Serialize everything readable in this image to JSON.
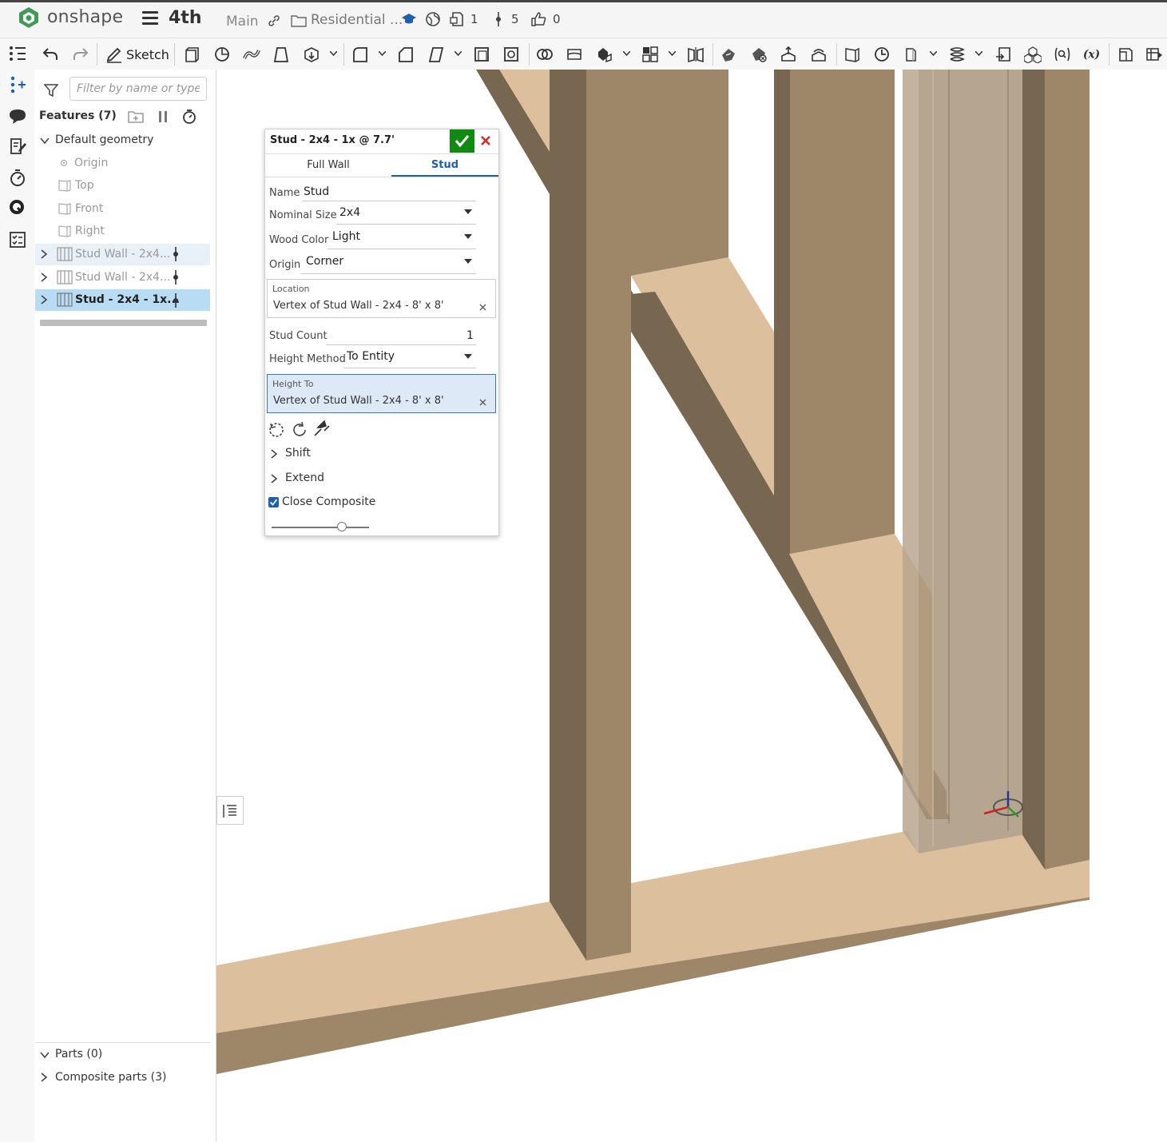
{
  "app": {
    "brand": "onshape",
    "doc_title": "4th",
    "branch": "Main",
    "folder": "Residential ...",
    "counts": {
      "parts_studio": "1",
      "versions": "5",
      "likes": "0"
    }
  },
  "toolbar": {
    "sketch_label": "Sketch"
  },
  "feature_tree": {
    "filter_placeholder": "Filter by name or type",
    "header": "Features (7)",
    "default_geometry": "Default geometry",
    "planes": [
      "Origin",
      "Top",
      "Front",
      "Right"
    ],
    "features": [
      "Stud Wall - 2x4...",
      "Stud Wall - 2x4...",
      "Stud - 2x4 - 1x..."
    ],
    "parts": "Parts (0)",
    "composite_parts": "Composite parts (3)"
  },
  "dialog": {
    "title": "Stud - 2x4 - 1x @ 7.7'",
    "tabs": [
      "Full Wall",
      "Stud"
    ],
    "active_tab": "Stud",
    "name_label": "Name",
    "name_value": "Stud",
    "nominal_size_label": "Nominal Size",
    "nominal_size_value": "2x4",
    "wood_color_label": "Wood Color",
    "wood_color_value": "Light",
    "origin_label": "Origin",
    "origin_value": "Corner",
    "location_label": "Location",
    "location_value": "Vertex of Stud Wall - 2x4 - 8' x 8'",
    "stud_count_label": "Stud Count",
    "stud_count_value": "1",
    "height_method_label": "Height Method",
    "height_method_value": "To Entity",
    "height_to_label": "Height To",
    "height_to_value": "Vertex of Stud Wall - 2x4 - 8' x 8'",
    "shift_label": "Shift",
    "extend_label": "Extend",
    "close_composite_label": "Close Composite",
    "close_composite_checked": true,
    "slider_level": 0.72
  },
  "colors": {
    "accent": "#1f5fae",
    "confirm": "#108a10",
    "cancel": "#c9302c",
    "wood_light": "#dcbf9d",
    "wood_mid": "#9e8668",
    "wood_dark": "#776650"
  }
}
